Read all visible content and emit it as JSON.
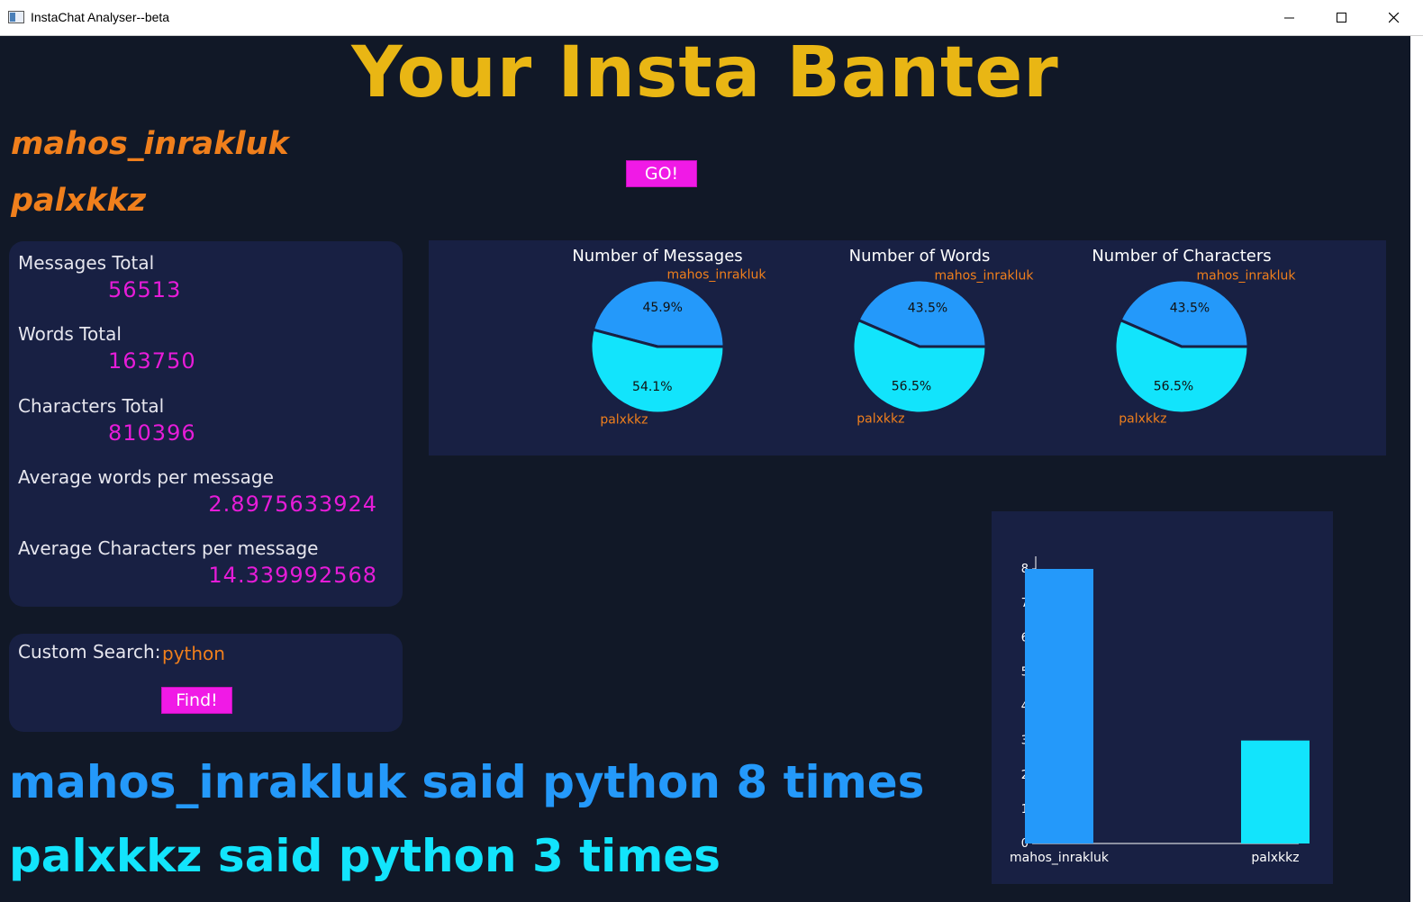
{
  "window": {
    "title": "InstaChat Analyser--beta"
  },
  "heading": "Your Insta Banter",
  "users": [
    "mahos_inrakluk",
    "palxkkz"
  ],
  "go_button": "GO!",
  "stats": {
    "messages_label": "Messages Total",
    "messages_value": "56513",
    "words_label": "Words Total",
    "words_value": "163750",
    "chars_label": "Characters Total",
    "chars_value": "810396",
    "avg_words_label": "Average words per message",
    "avg_words_value": "2.8975633924",
    "avg_chars_label": "Average Characters per message",
    "avg_chars_value": "14.339992568"
  },
  "search": {
    "label": "Custom Search:",
    "value": "python",
    "find_button": "Find!"
  },
  "results": [
    "mahos_inrakluk said python 8 times",
    "palxkkz said python 3 times"
  ],
  "colors": {
    "user1": "#2499fa",
    "user2": "#12e4fc",
    "accent": "#f01ae6",
    "heading": "#e9b614",
    "label": "#f07f1c"
  },
  "chart_data": [
    {
      "type": "pie",
      "title": "Number of Messages",
      "labels": [
        "mahos_inrakluk",
        "palxkkz"
      ],
      "values": [
        45.9,
        54.1
      ],
      "value_labels": [
        "45.9%",
        "54.1%"
      ]
    },
    {
      "type": "pie",
      "title": "Number of Words",
      "labels": [
        "mahos_inrakluk",
        "palxkkz"
      ],
      "values": [
        43.5,
        56.5
      ],
      "value_labels": [
        "43.5%",
        "56.5%"
      ]
    },
    {
      "type": "pie",
      "title": "Number of Characters",
      "labels": [
        "mahos_inrakluk",
        "palxkkz"
      ],
      "values": [
        43.5,
        56.5
      ],
      "value_labels": [
        "43.5%",
        "56.5%"
      ]
    },
    {
      "type": "bar",
      "title": "",
      "xlabel": "",
      "ylabel": "",
      "categories": [
        "mahos_inrakluk",
        "palxkkz"
      ],
      "values": [
        8,
        3
      ],
      "ylim": [
        0,
        8
      ],
      "yticks": [
        "0",
        "1",
        "2",
        "3",
        "4",
        "5",
        "6",
        "7",
        "8"
      ]
    }
  ]
}
